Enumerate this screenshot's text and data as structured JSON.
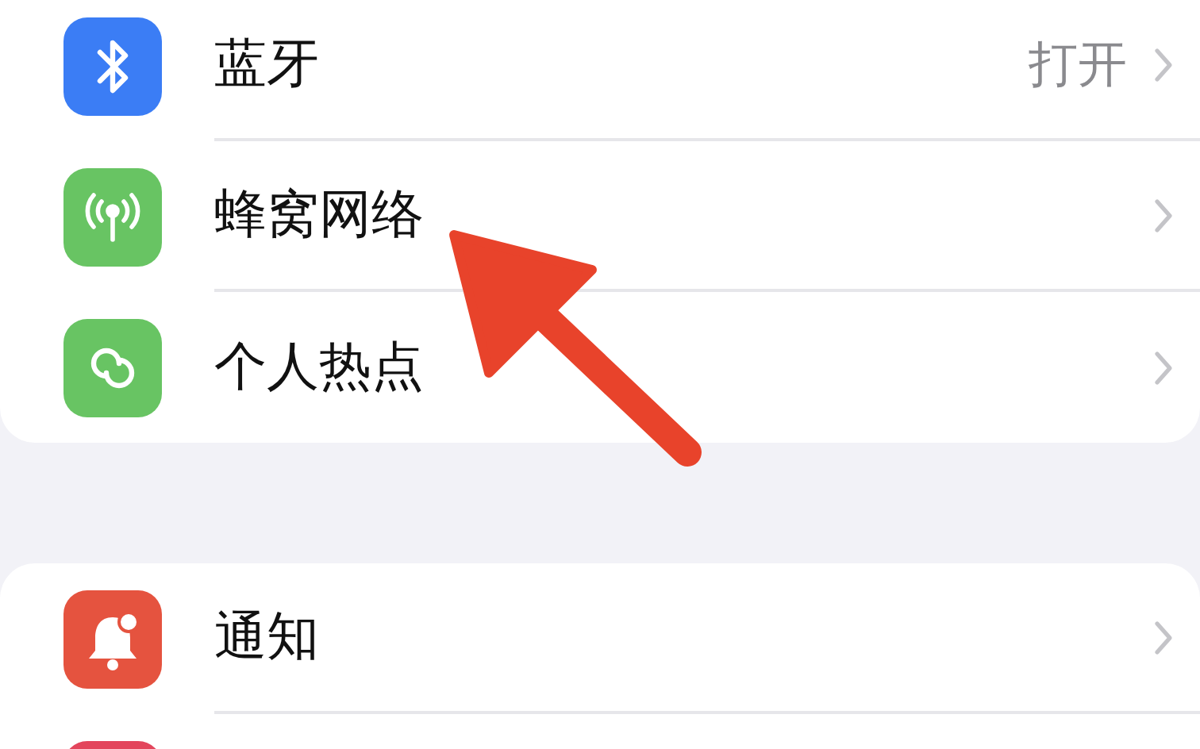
{
  "sections": [
    {
      "items": [
        {
          "kind": "bluetooth",
          "label": "蓝牙",
          "value": "打开",
          "color": "#3b7df5"
        },
        {
          "kind": "cellular",
          "label": "蜂窝网络",
          "color": "#68c463"
        },
        {
          "kind": "hotspot",
          "label": "个人热点",
          "color": "#68c463"
        }
      ]
    },
    {
      "items": [
        {
          "kind": "notifications",
          "label": "通知",
          "color": "#e5533f"
        },
        {
          "kind": "tile",
          "color": "#e3455c"
        }
      ]
    }
  ]
}
